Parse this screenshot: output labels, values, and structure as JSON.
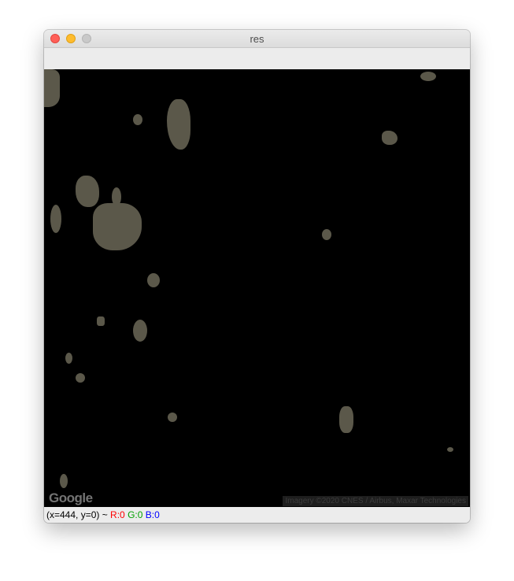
{
  "window": {
    "title": "res"
  },
  "map": {
    "logo_text": "Google",
    "attribution": "Imagery ©2020 CNES / Airbus, Maxar Technologies"
  },
  "status": {
    "coords": "(x=444, y=0) ~ ",
    "r": "R:0",
    "g": "G:0",
    "b": "B:0",
    "colors": {
      "r": "#ff0000",
      "g": "#00a000",
      "b": "#0000ff"
    }
  }
}
